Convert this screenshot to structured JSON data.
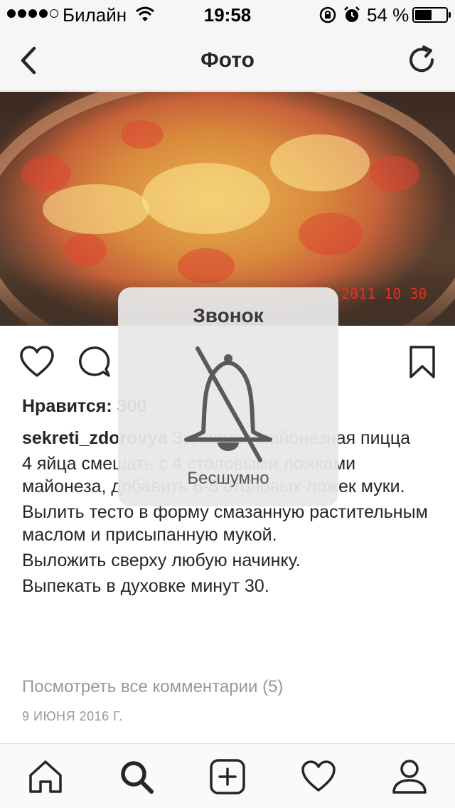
{
  "status_bar": {
    "carrier": "Билайн",
    "time": "19:58",
    "battery_percent": "54 %",
    "battery_level": 0.54,
    "signal_bars": 4,
    "icons": [
      "wifi-icon",
      "rotation-lock-icon",
      "alarm-icon",
      "battery-icon"
    ]
  },
  "nav": {
    "title": "Фото",
    "back_icon": "chevron-left-icon",
    "refresh_icon": "refresh-icon"
  },
  "photo": {
    "date_stamp": "2011 10 30"
  },
  "actions": {
    "icons": [
      "heart-icon",
      "comment-icon",
      "bookmark-icon"
    ]
  },
  "post": {
    "likes": "Нравится: 300",
    "username": "sekreti_zdorovya",
    "caption_lines": [
      "Заливная майонезная пицца",
      "4 яйца смешать с 4 столовыми ложками майонеза, добавить 6-8 столовых ложек муки.",
      "Вылить тесто в форму смазанную растительным маслом и присыпанную мукой.",
      "Выложить сверху любую начинку.",
      "Выпекать в духовке минут 30."
    ],
    "view_comments": "Посмотреть все комментарии (5)",
    "date": "9 ИЮНЯ 2016 Г."
  },
  "hud": {
    "title": "Звонок",
    "subtitle": "Бесшумно",
    "icon": "bell-muted-icon"
  },
  "tabbar": {
    "items": [
      "home-icon",
      "search-icon",
      "add-post-icon",
      "activity-heart-icon",
      "profile-icon"
    ],
    "active": "search-icon"
  },
  "colors": {
    "text": "#262626",
    "muted": "#999999",
    "bar_bg": "#f6f6f6"
  }
}
